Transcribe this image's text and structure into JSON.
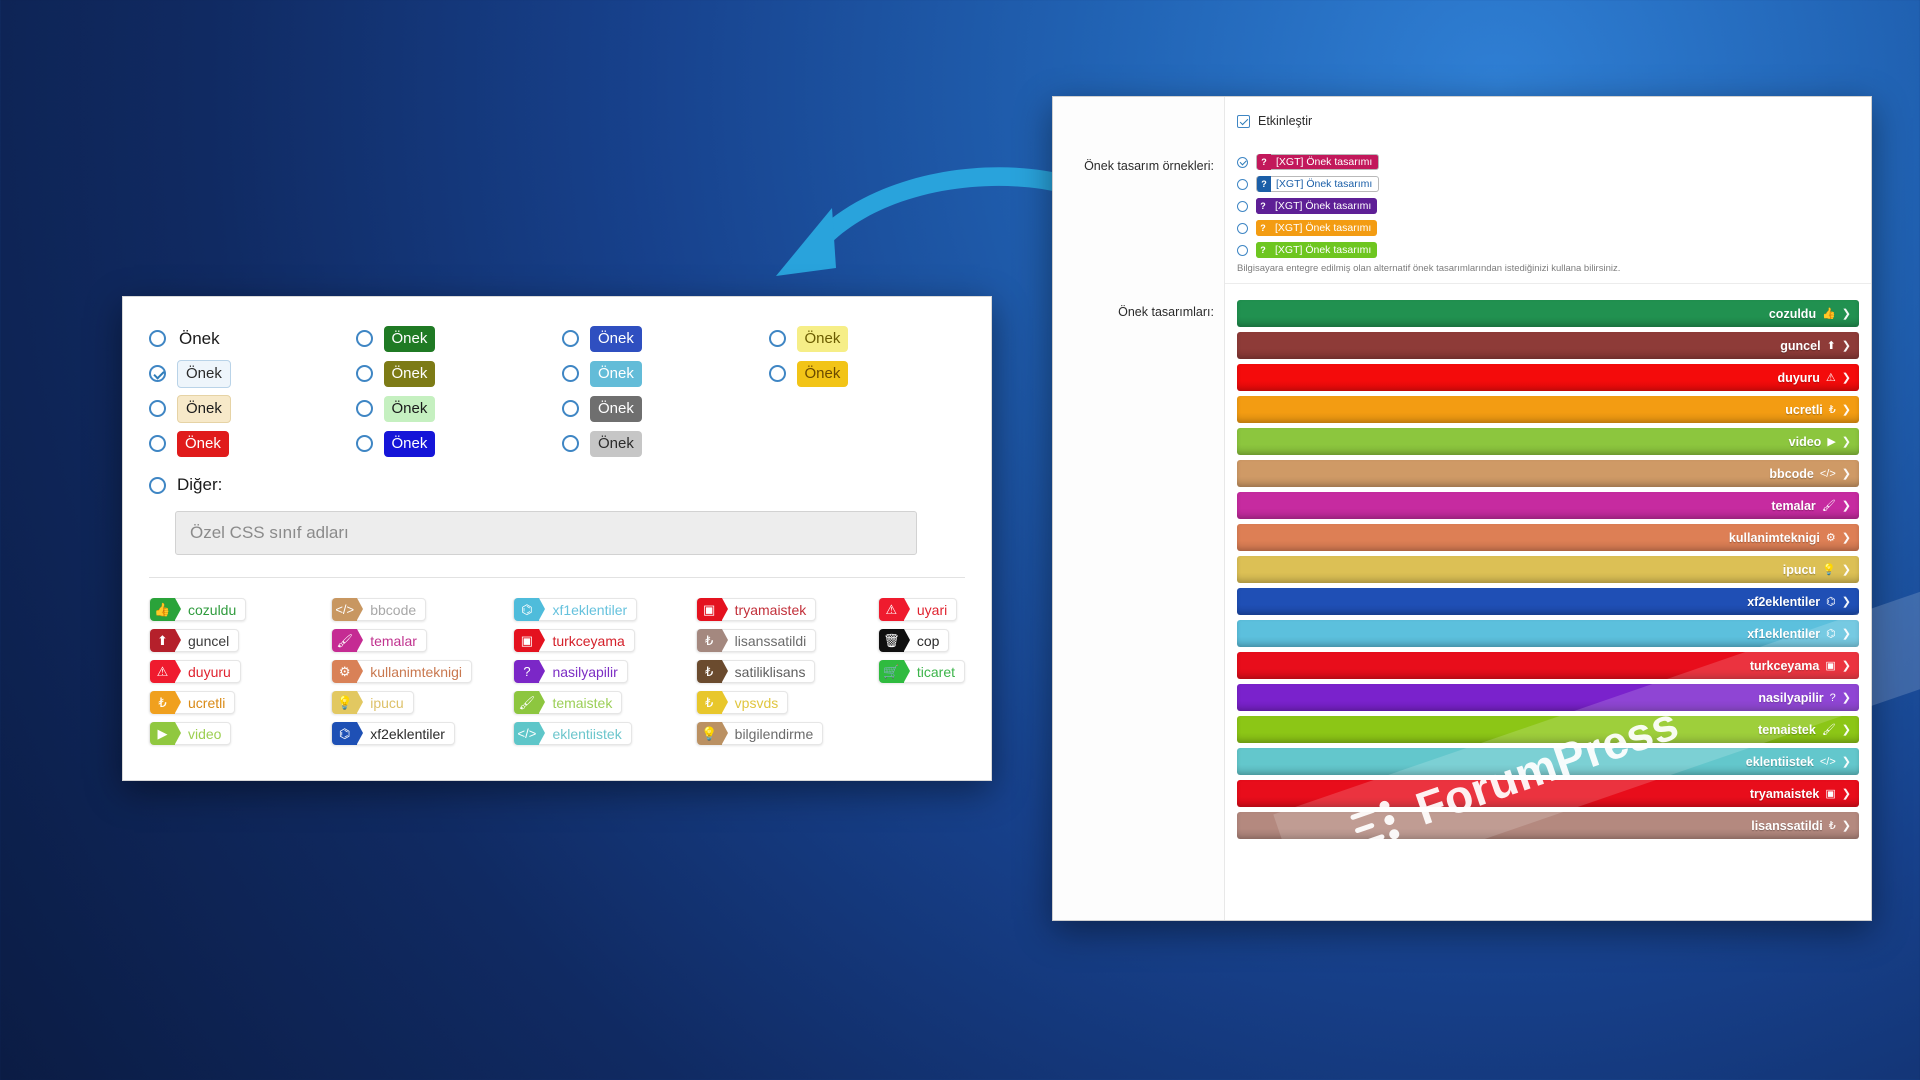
{
  "left_panel": {
    "prefix_options": [
      {
        "label": "Önek",
        "style": "plain",
        "selected": false
      },
      {
        "label": "Önek",
        "style": "chip",
        "bg": "#eef5fb",
        "fg": "#2b2b2b",
        "border": "#b9d3e8",
        "selected": true
      },
      {
        "label": "Önek",
        "style": "chip",
        "bg": "#f7e9c9",
        "fg": "#1b1b1b",
        "border": "#e6d3a5",
        "selected": false
      },
      {
        "label": "Önek",
        "style": "chip",
        "bg": "#e01b1b",
        "fg": "#ffffff",
        "selected": false
      },
      {
        "label": "Önek",
        "style": "chip",
        "bg": "#1f7a24",
        "fg": "#ffffff",
        "selected": false
      },
      {
        "label": "Önek",
        "style": "chip",
        "bg": "#7d7b16",
        "fg": "#ffffff",
        "selected": false
      },
      {
        "label": "Önek",
        "style": "chip",
        "bg": "#c5f0c0",
        "fg": "#1b1b1b",
        "selected": false
      },
      {
        "label": "Önek",
        "style": "chip",
        "bg": "#1515d8",
        "fg": "#ffffff",
        "selected": false
      },
      {
        "label": "Önek",
        "style": "chip",
        "bg": "#2f4fc0",
        "fg": "#ffffff",
        "selected": false
      },
      {
        "label": "Önek",
        "style": "chip",
        "bg": "#63bcd8",
        "fg": "#ffffff",
        "selected": false
      },
      {
        "label": "Önek",
        "style": "chip",
        "bg": "#6f6f6f",
        "fg": "#ffffff",
        "selected": false
      },
      {
        "label": "Önek",
        "style": "chip",
        "bg": "#c6c6c6",
        "fg": "#2b2b2b",
        "selected": false
      },
      {
        "label": "Önek",
        "style": "chip",
        "bg": "#f6ee87",
        "fg": "#6b5c00",
        "selected": false
      },
      {
        "label": "Önek",
        "style": "chip",
        "bg": "#f2c417",
        "fg": "#6b4a00",
        "selected": false
      }
    ],
    "other_label": "Diğer:",
    "css_class_placeholder": "Özel CSS sınıf adları",
    "badges": [
      {
        "label": "cozuldu",
        "color": "#2aa33a",
        "text_color": "#2f9b3d",
        "icon": "thumbs-up-icon",
        "glyph": "👍"
      },
      {
        "label": "guncel",
        "color": "#b5202b",
        "text_color": "#3a3a3a",
        "icon": "arrow-up-box-icon",
        "glyph": "⬆"
      },
      {
        "label": "duyuru",
        "color": "#ef1b2e",
        "text_color": "#e0232f",
        "icon": "warning-triangle-icon",
        "glyph": "⚠"
      },
      {
        "label": "ucretli",
        "color": "#f0a01e",
        "text_color": "#d98a16",
        "icon": "lira-icon",
        "glyph": "₺"
      },
      {
        "label": "video",
        "color": "#90c83f",
        "text_color": "#9dcf52",
        "icon": "play-icon",
        "glyph": "▶"
      },
      {
        "label": "bbcode",
        "color": "#c89761",
        "text_color": "#a8a8a8",
        "icon": "code-icon",
        "glyph": "</>"
      },
      {
        "label": "temalar",
        "color": "#c52b93",
        "text_color": "#c0338f",
        "icon": "brush-icon",
        "glyph": "🖌"
      },
      {
        "label": "kullanimteknigi",
        "color": "#d98157",
        "text_color": "#c9784f",
        "icon": "gear-icon",
        "glyph": "⚙"
      },
      {
        "label": "ipucu",
        "color": "#e2c861",
        "text_color": "#ddc169",
        "icon": "lightbulb-icon",
        "glyph": "💡"
      },
      {
        "label": "xf2eklentiler",
        "color": "#1e50b5",
        "text_color": "#2b2b2b",
        "icon": "robot-icon",
        "glyph": "⌬"
      },
      {
        "label": "xf1eklentiler",
        "color": "#4fbcdb",
        "text_color": "#66c2dd",
        "icon": "robot-icon",
        "glyph": "⌬"
      },
      {
        "label": "turkceyama",
        "color": "#e4121f",
        "text_color": "#d4202a",
        "icon": "flag-card-icon",
        "glyph": "▣"
      },
      {
        "label": "nasilyapilir",
        "color": "#7b27c7",
        "text_color": "#7c2dc4",
        "icon": "question-icon",
        "glyph": "?"
      },
      {
        "label": "temaistek",
        "color": "#8dc63f",
        "text_color": "#9ccf58",
        "icon": "brush-icon",
        "glyph": "🖌"
      },
      {
        "label": "eklentiistek",
        "color": "#5ec6c9",
        "text_color": "#6cc6cc",
        "icon": "code-icon",
        "glyph": "</>"
      },
      {
        "label": "tryamaistek",
        "color": "#e4121f",
        "text_color": "#c2303a",
        "icon": "flag-card-icon",
        "glyph": "▣"
      },
      {
        "label": "lisanssatildi",
        "color": "#a4887f",
        "text_color": "#6b6b6b",
        "icon": "lira-icon",
        "glyph": "₺"
      },
      {
        "label": "satiliklisans",
        "color": "#6b4b2e",
        "text_color": "#5f5f5f",
        "icon": "lira-icon",
        "glyph": "₺"
      },
      {
        "label": "vpsvds",
        "color": "#e8c72c",
        "text_color": "#e0c63f",
        "icon": "lira-icon",
        "glyph": "₺"
      },
      {
        "label": "bilgilendirme",
        "color": "#bb9162",
        "text_color": "#6b6b6b",
        "icon": "idea-icon",
        "glyph": "💡"
      },
      {
        "label": "uyari",
        "color": "#ef1b2e",
        "text_color": "#e0232f",
        "icon": "warning-triangle-icon",
        "glyph": "⚠"
      },
      {
        "label": "cop",
        "color": "#101010",
        "text_color": "#2b2b2b",
        "icon": "trash-icon",
        "glyph": "🗑"
      },
      {
        "label": "ticaret",
        "color": "#2fbb3f",
        "text_color": "#3cb44a",
        "icon": "cart-icon",
        "glyph": "🛒"
      }
    ]
  },
  "right_panel": {
    "enable_label": "Etkinleştir",
    "examples_label": "Önek tasarım örnekleri:",
    "examples": [
      {
        "text": "[XGT] Önek tasarımı",
        "bg": "#c2185b",
        "fg": "#ffffff",
        "icon_bg": "#c2185b",
        "selected": true,
        "outlined": true
      },
      {
        "text": "[XGT] Önek tasarımı",
        "bg": "#ffffff",
        "fg": "#1b5fa8",
        "icon_bg": "#1b5fa8",
        "selected": false,
        "outlined": true
      },
      {
        "text": "[XGT] Önek tasarımı",
        "bg": "#5e1f96",
        "fg": "#ffffff",
        "icon_bg": "#5e1f96",
        "selected": false,
        "outlined": false
      },
      {
        "text": "[XGT] Önek tasarımı",
        "bg": "#f39c12",
        "fg": "#ffffff",
        "icon_bg": "#f39c12",
        "selected": false,
        "outlined": false
      },
      {
        "text": "[XGT] Önek tasarımı",
        "bg": "#6ec620",
        "fg": "#ffffff",
        "icon_bg": "#6ec620",
        "selected": false,
        "outlined": false
      }
    ],
    "hint": "Bilgisayara entegre edilmiş olan alternatif önek tasarımlarından istediğinizi kullana bilirsiniz.",
    "designs_label": "Önek tasarımları:",
    "bars": [
      {
        "label": "cozuldu",
        "color": "#219150",
        "glyph": "👍"
      },
      {
        "label": "guncel",
        "color": "#8e3b38",
        "glyph": "⬆"
      },
      {
        "label": "duyuru",
        "color": "#f40b0b",
        "glyph": "⚠"
      },
      {
        "label": "ucretli",
        "color": "#f39c12",
        "glyph": "₺"
      },
      {
        "label": "video",
        "color": "#8cc63e",
        "glyph": "▶"
      },
      {
        "label": "bbcode",
        "color": "#cf9a66",
        "glyph": "</>"
      },
      {
        "label": "temalar",
        "color": "#c62ba0",
        "glyph": "🖌"
      },
      {
        "label": "kullanimteknigi",
        "color": "#dd7f55",
        "glyph": "⚙"
      },
      {
        "label": "ipucu",
        "color": "#dcc055",
        "glyph": "💡"
      },
      {
        "label": "xf2eklentiler",
        "color": "#1f4fb5",
        "glyph": "⌬"
      },
      {
        "label": "xf1eklentiler",
        "color": "#5cc0dd",
        "glyph": "⌬"
      },
      {
        "label": "turkceyama",
        "color": "#e80d1b",
        "glyph": "▣"
      },
      {
        "label": "nasilyapilir",
        "color": "#7a22cc",
        "glyph": "?"
      },
      {
        "label": "temaistek",
        "color": "#8cc616",
        "glyph": "🖌"
      },
      {
        "label": "eklentiistek",
        "color": "#63c7cc",
        "glyph": "</>"
      },
      {
        "label": "tryamaistek",
        "color": "#e80d1b",
        "glyph": "▣"
      },
      {
        "label": "lisanssatildi",
        "color": "#b4897f",
        "glyph": "₺"
      }
    ]
  },
  "watermark": {
    "text": "ForumPress"
  },
  "colors": {
    "accent": "#29a3dc",
    "page_bg": "#12356f"
  }
}
